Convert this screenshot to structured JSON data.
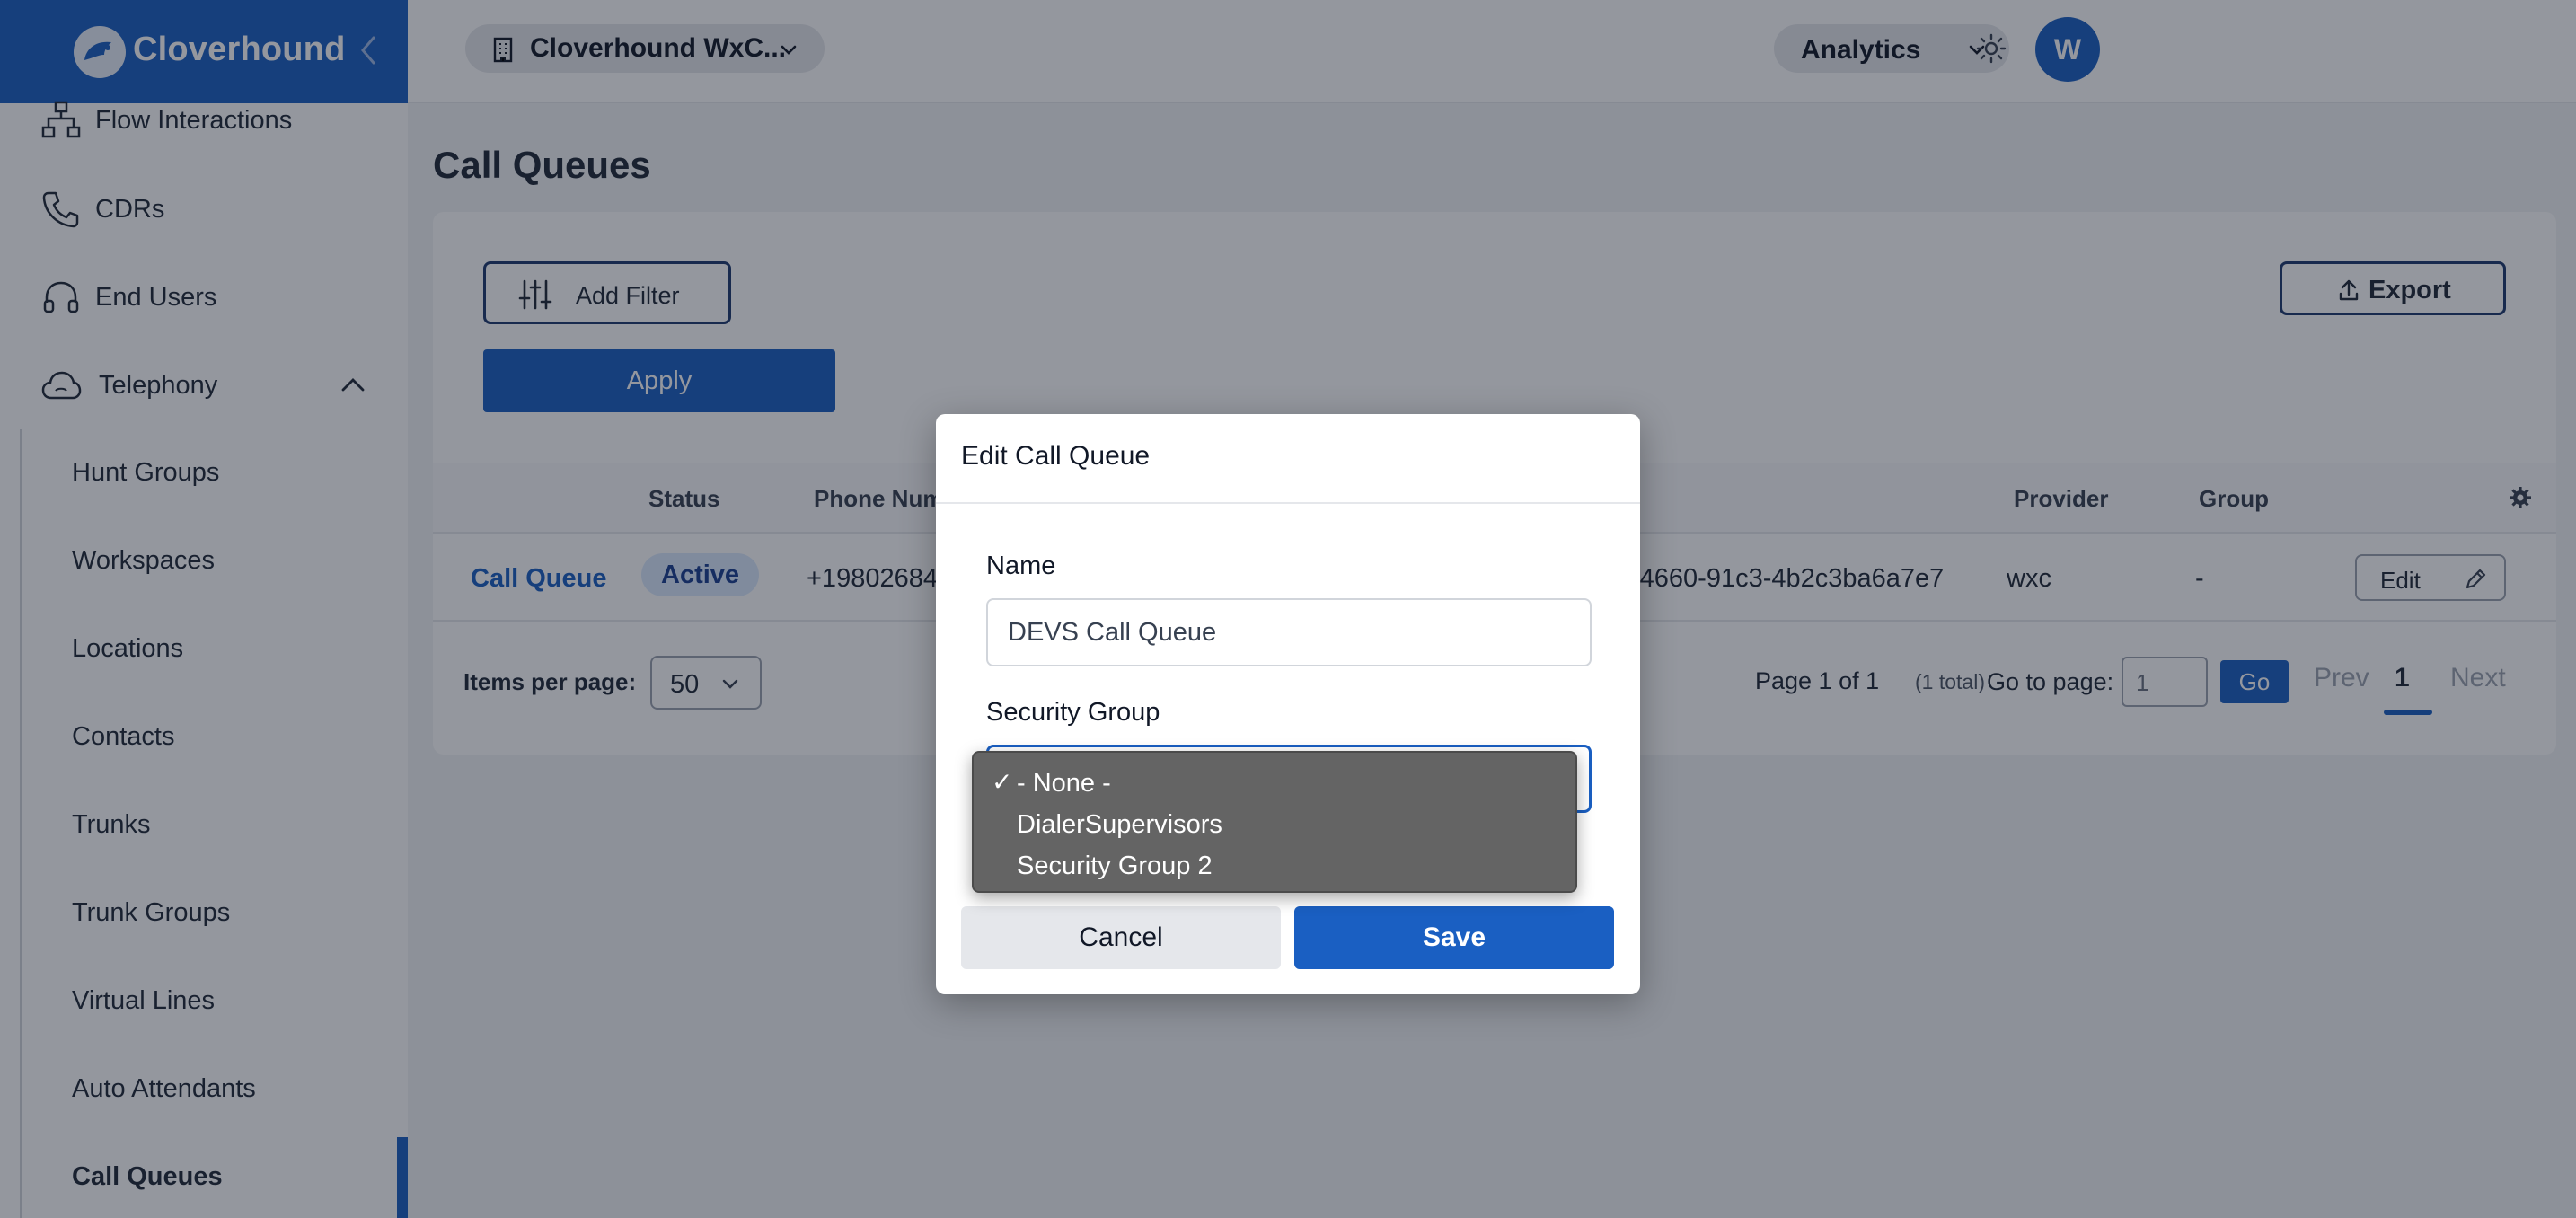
{
  "brand": {
    "name": "Cloverhound"
  },
  "sidebar": {
    "items": [
      {
        "label": "Flow Interactions"
      },
      {
        "label": "CDRs"
      },
      {
        "label": "End Users"
      },
      {
        "label": "Telephony"
      }
    ],
    "telephony_children": [
      {
        "label": "Hunt Groups"
      },
      {
        "label": "Workspaces"
      },
      {
        "label": "Locations"
      },
      {
        "label": "Contacts"
      },
      {
        "label": "Trunks"
      },
      {
        "label": "Trunk Groups"
      },
      {
        "label": "Virtual Lines"
      },
      {
        "label": "Auto Attendants"
      },
      {
        "label": "Call Queues"
      }
    ],
    "active_item": "Call Queues"
  },
  "header": {
    "tenant": "Cloverhound WxC...",
    "analytics": "Analytics",
    "avatar_initial": "W"
  },
  "page": {
    "title": "Call Queues",
    "add_filter": "Add Filter",
    "apply": "Apply",
    "export": "Export"
  },
  "table": {
    "headers": {
      "status": "Status",
      "phone": "Phone Num",
      "provider": "Provider",
      "group": "Group"
    },
    "row": {
      "name": "Call Queue",
      "status": "Active",
      "phone": "+19802684",
      "id": "-4660-91c3-4b2c3ba6a7e7",
      "provider": "wxc",
      "group": "-",
      "edit": "Edit"
    }
  },
  "pagination": {
    "items_per_page_label": "Items per page:",
    "items_per_page": "50",
    "page_text": "Page 1  of  1",
    "total": "(1 total)",
    "goto_label": "Go to page:",
    "goto_value": "1",
    "go": "Go",
    "prev": "Prev",
    "current": "1",
    "next": "Next"
  },
  "modal": {
    "title": "Edit Call Queue",
    "name_label": "Name",
    "name_value": "DEVS Call Queue",
    "security_group_label": "Security Group",
    "options": [
      {
        "label": "- None -",
        "checked": true
      },
      {
        "label": "DialerSupervisors",
        "checked": false
      },
      {
        "label": "Security Group 2",
        "checked": false
      }
    ],
    "check_glyph": "✓",
    "cancel": "Cancel",
    "save": "Save"
  },
  "colors": {
    "accent": "#1a5fc2",
    "overlay": "rgba(17,24,39,0.45)",
    "dropdown_bg": "#646464"
  }
}
